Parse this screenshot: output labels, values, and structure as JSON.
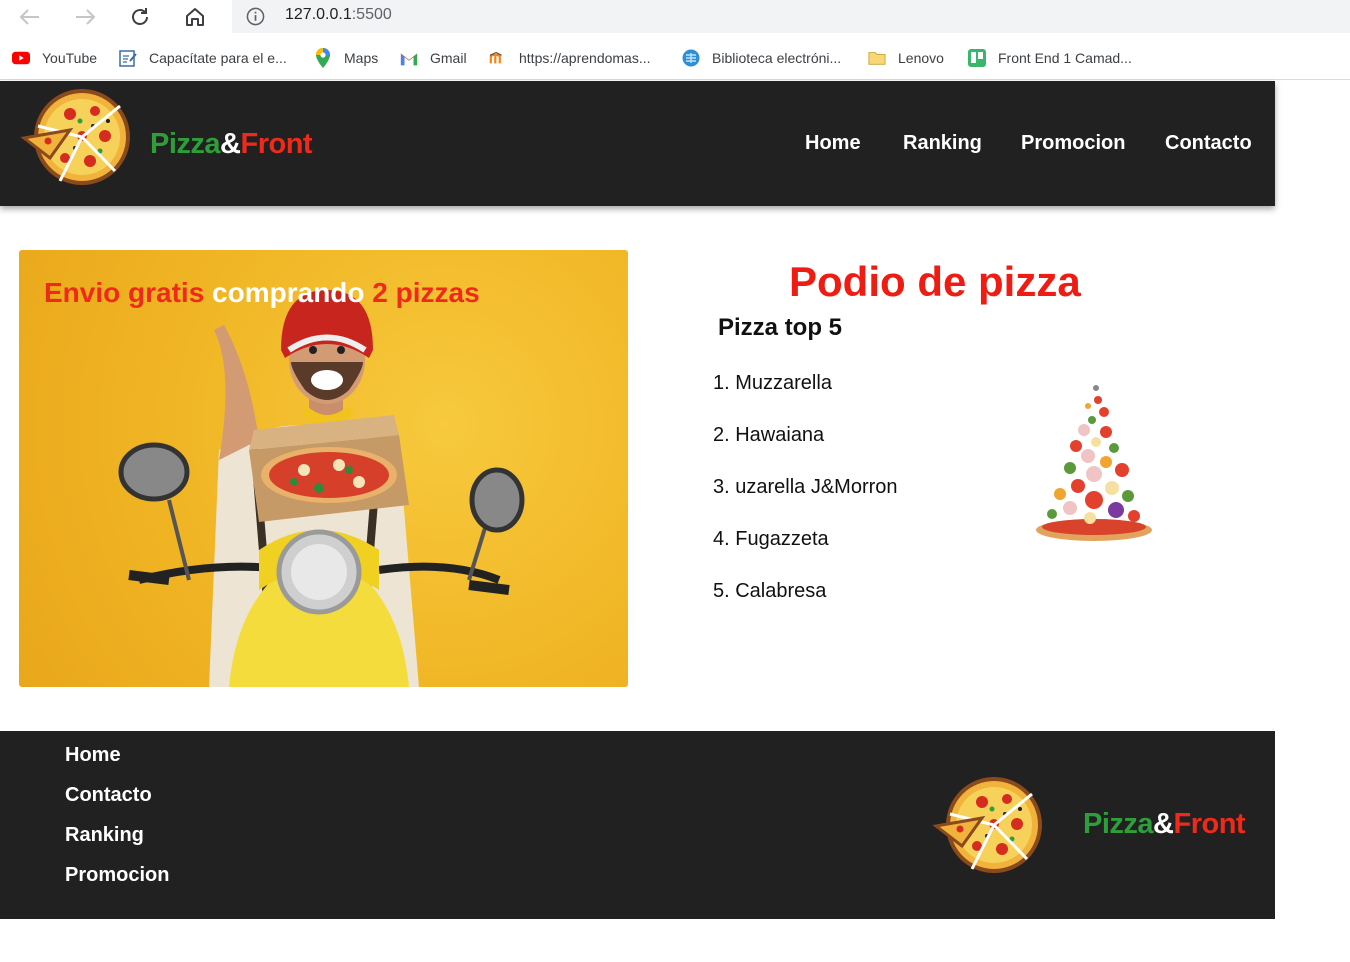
{
  "browser": {
    "url_host": "127.0.0.1",
    "url_port": ":5500",
    "bookmarks": [
      {
        "label": "YouTube",
        "icon": "youtube-icon"
      },
      {
        "label": "Capacítate para el e...",
        "icon": "course-icon"
      },
      {
        "label": "Maps",
        "icon": "maps-icon"
      },
      {
        "label": "Gmail",
        "icon": "gmail-icon"
      },
      {
        "label": "https://aprendomas...",
        "icon": "moodle-icon"
      },
      {
        "label": "Biblioteca electróni...",
        "icon": "library-icon"
      },
      {
        "label": "Lenovo",
        "icon": "folder-icon"
      },
      {
        "label": "Front End 1 Camad...",
        "icon": "trello-icon"
      }
    ]
  },
  "header": {
    "brand": {
      "part1": "Pizza",
      "part2": "&",
      "part3": "Front"
    },
    "nav": [
      "Home",
      "Ranking",
      "Promocion",
      "Contacto"
    ]
  },
  "promo": {
    "part1": "Envio gratis",
    "part2": " comprando ",
    "part3": "2 pizzas"
  },
  "podium": {
    "title": "Podio de pizza",
    "subtitle": "Pizza top 5",
    "items": [
      "1. Muzzarella",
      "2. Hawaiana",
      "3. uzarella J&Morron",
      "4. Fugazzeta",
      "5. Calabresa"
    ]
  },
  "footer": {
    "links": [
      "Home",
      "Contacto",
      "Ranking",
      "Promocion"
    ],
    "brand": {
      "part1": "Pizza",
      "part2": "&",
      "part3": "Front"
    }
  },
  "colors": {
    "header_bg": "#212121",
    "brand_green": "#2e9e3a",
    "brand_red": "#ee2a1b",
    "podium_red": "#ee1c12",
    "promo_yellow": "#f0b524"
  }
}
